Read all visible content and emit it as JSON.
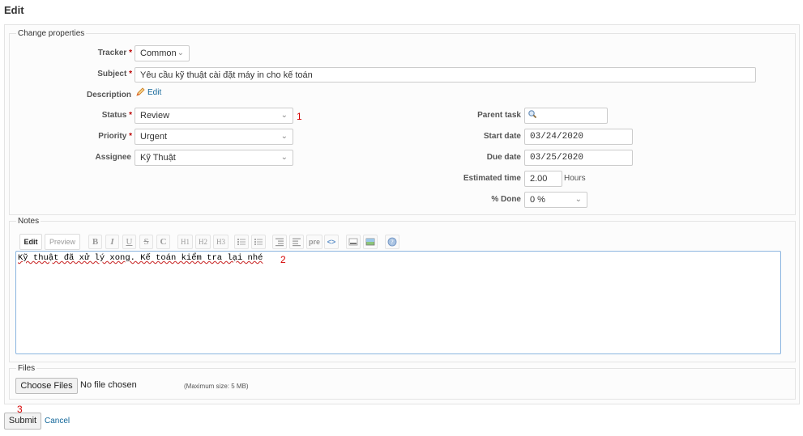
{
  "page": {
    "title": "Edit"
  },
  "properties": {
    "legend": "Change properties",
    "tracker": {
      "label": "Tracker",
      "value": "Common"
    },
    "subject": {
      "label": "Subject",
      "value": "Yêu cầu kỹ thuật cài đặt máy in cho kế toán"
    },
    "description": {
      "label": "Description",
      "edit_label": "Edit"
    },
    "status": {
      "label": "Status",
      "value": "Review"
    },
    "priority": {
      "label": "Priority",
      "value": "Urgent"
    },
    "assignee": {
      "label": "Assignee",
      "value": "Kỹ Thuật"
    },
    "parent_task": {
      "label": "Parent task",
      "value": ""
    },
    "start_date": {
      "label": "Start date",
      "value": "03/24/2020"
    },
    "due_date": {
      "label": "Due date",
      "value": "03/25/2020"
    },
    "estimated_time": {
      "label": "Estimated time",
      "value": "2.00",
      "unit": "Hours"
    },
    "done": {
      "label": "% Done",
      "value": "0 %"
    },
    "required_mark": "*"
  },
  "notes": {
    "legend": "Notes",
    "tabs": {
      "edit": "Edit",
      "preview": "Preview"
    },
    "toolbar": {
      "bold": "B",
      "italic": "I",
      "underline": "U",
      "strike": "S",
      "code": "C",
      "h1": "H1",
      "h2": "H2",
      "h3": "H3",
      "pre": "pre",
      "inline_code": "<>"
    },
    "text": "Kỹ thuật đã xử lý xong. Kế toán kiểm tra lại nhé"
  },
  "files": {
    "legend": "Files",
    "choose_label": "Choose Files",
    "status": "No file chosen",
    "max_size": "(Maximum size: 5 MB)"
  },
  "actions": {
    "submit": "Submit",
    "cancel": "Cancel"
  },
  "annotations": {
    "m1": "1",
    "m2": "2",
    "m3": "3"
  },
  "colors": {
    "link": "#116699",
    "required": "#bb0000",
    "marker": "#d40000",
    "focus_border": "#8bb5e0"
  }
}
